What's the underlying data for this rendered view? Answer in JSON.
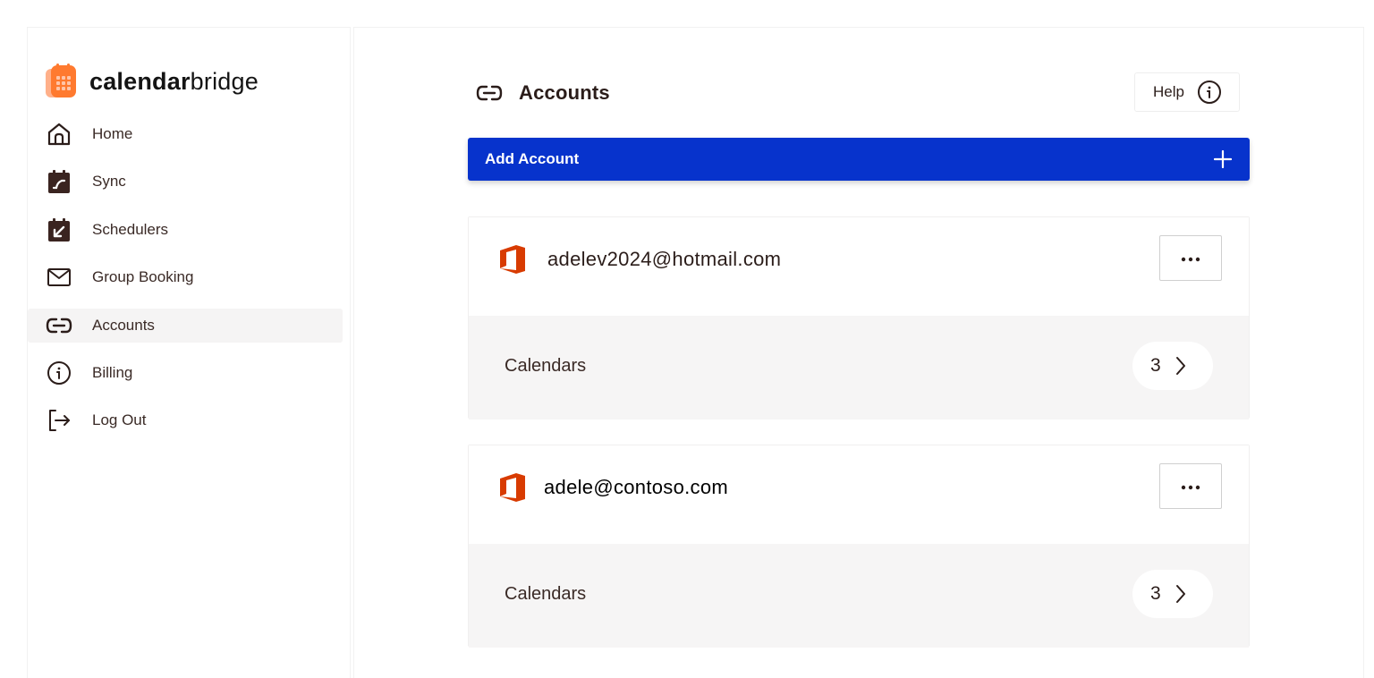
{
  "brand": {
    "name_bold": "calendar",
    "name_light": "bridge"
  },
  "sidebar": {
    "items": [
      {
        "label": "Home",
        "icon": "home-icon",
        "active": false
      },
      {
        "label": "Sync",
        "icon": "sync-calendar-icon",
        "active": false
      },
      {
        "label": "Schedulers",
        "icon": "scheduler-calendar-icon",
        "active": false
      },
      {
        "label": "Group Booking",
        "icon": "mail-icon",
        "active": false
      },
      {
        "label": "Accounts",
        "icon": "link-icon",
        "active": true
      },
      {
        "label": "Billing",
        "icon": "info-icon",
        "active": false
      },
      {
        "label": "Log Out",
        "icon": "logout-icon",
        "active": false
      }
    ]
  },
  "main": {
    "title": "Accounts",
    "title_icon": "link-icon",
    "help_label": "Help",
    "add_account_label": "Add Account",
    "accounts": [
      {
        "email": "adelev2024@hotmail.com",
        "calendars_label": "Calendars",
        "calendar_count": "3"
      },
      {
        "email": "adele@contoso.com",
        "calendars_label": "Calendars",
        "calendar_count": "3"
      }
    ]
  },
  "colors": {
    "primary": "#0733cc",
    "brand_orange": "#ff7a2f",
    "office_red": "#d83b01",
    "text_dark": "#2b1d1a",
    "active_bg": "#f5f4f4",
    "card_section_bg": "#f6f5f5"
  }
}
